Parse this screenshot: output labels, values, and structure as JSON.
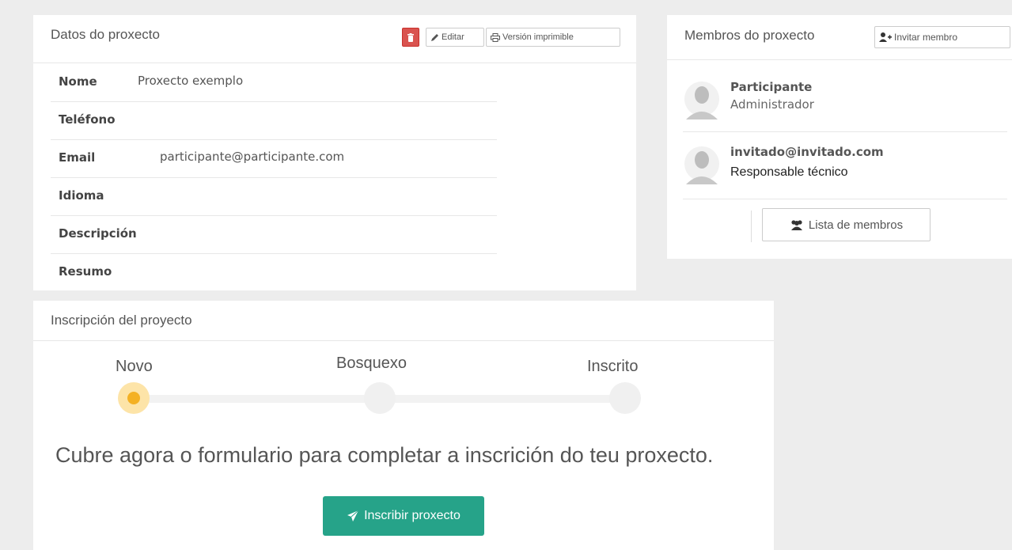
{
  "project": {
    "title": "Datos do proxecto",
    "buttons": {
      "delete_icon": "trash-icon",
      "edit_label": "Editar",
      "print_label": "Versión imprimible"
    },
    "fields": [
      {
        "label": "Nome",
        "value": "Proxecto exemplo"
      },
      {
        "label": "Teléfono",
        "value": ""
      },
      {
        "label": "Email",
        "value": "participante@participante.com"
      },
      {
        "label": "Idioma",
        "value": ""
      },
      {
        "label": "Descripción",
        "value": ""
      },
      {
        "label": "Resumo",
        "value": ""
      }
    ]
  },
  "members": {
    "title": "Membros do proxecto",
    "invite_label": "Invitar membro",
    "list": [
      {
        "name": "Participante",
        "role": "Administrador"
      },
      {
        "name": "invitado@invitado.com",
        "role": "Responsable técnico"
      }
    ],
    "list_button_label": "Lista de membros"
  },
  "inscription": {
    "title": "Inscripción del proyecto",
    "steps": [
      "Novo",
      "Bosquexo",
      "Inscrito"
    ],
    "current_step": "Novo",
    "message": "Cubre agora o formulario para completar a inscrición do teu proxecto.",
    "submit_label": "Inscribir proxecto"
  },
  "colors": {
    "danger": "#d9534f",
    "primary": "#26a389",
    "step_active": "#f4b124"
  }
}
